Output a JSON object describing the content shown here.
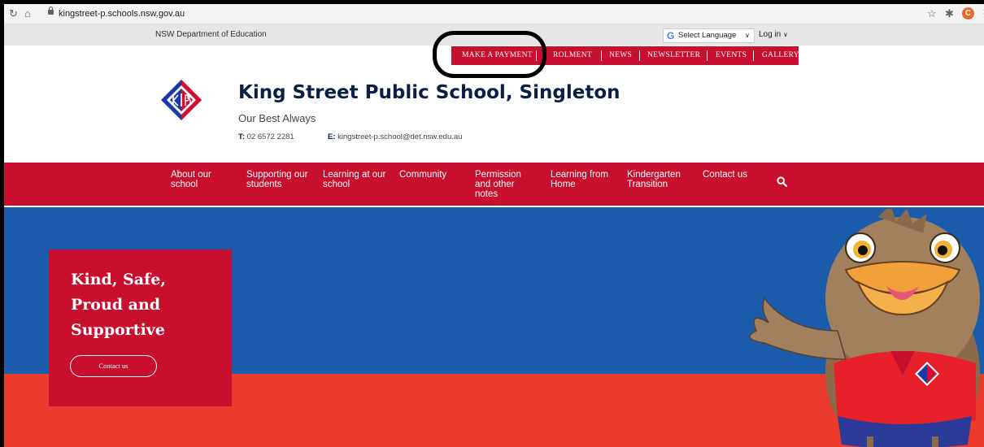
{
  "browser": {
    "url": "kingstreet-p.schools.nsw.gov.au",
    "avatar_letter": "C"
  },
  "utility_bar": {
    "department": "NSW Department of Education",
    "language_label": "Select Language",
    "login_label": "Log in"
  },
  "quick_links": [
    "MAKE A PAYMENT",
    "ROLMENT",
    "NEWS",
    "NEWSLETTER",
    "EVENTS",
    "GALLERY"
  ],
  "header": {
    "school_name": "King Street Public School, Singleton",
    "tagline": "Our Best Always",
    "phone_label": "T:",
    "phone": "02 6572 2281",
    "email_label": "E:",
    "email": "kingstreet-p.school@det.nsw.edu.au"
  },
  "main_nav": [
    "About our school",
    "Supporting our students",
    "Learning at our school",
    "Community",
    "Permission and other notes",
    "Learning from Home",
    "Kindergarten Transition",
    "Contact us"
  ],
  "hero": {
    "title": "Kind, Safe,\nProud and\nSupportive",
    "button_label": "Contact us"
  },
  "colors": {
    "brand_red": "#c8102e",
    "hero_blue": "#1a5bac",
    "hero_red": "#ea3b2c",
    "navy": "#0a1f44"
  }
}
